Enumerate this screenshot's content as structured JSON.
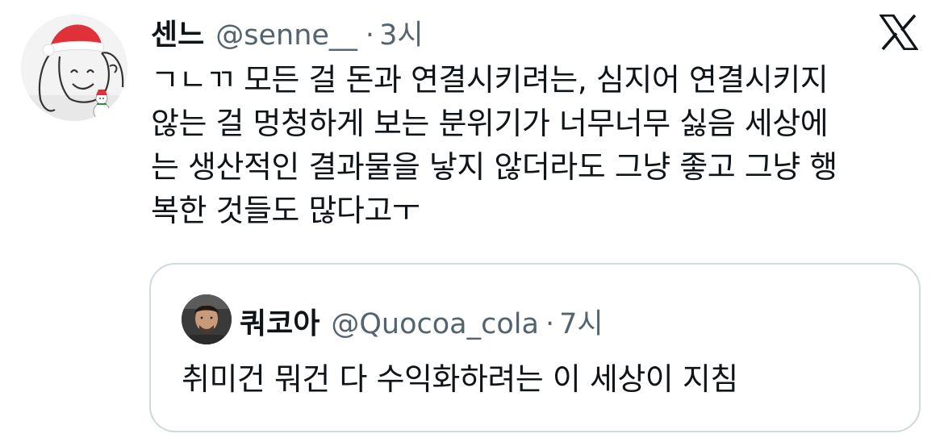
{
  "tweet": {
    "display_name": "센느",
    "handle": "@senne__",
    "separator": "·",
    "time": "3시",
    "text": "ㄱㄴㄲ 모든 걸 돈과 연결시키려는, 심지어 연결시키지\n않는 걸 멍청하게 보는 분위기가 너무너무 싫음 세상에\n는 생산적인 결과물을 낳지 않더라도 그냥 좋고 그냥 행\n복한 것들도 많다고ㅜ",
    "avatar_icon": "santa-hat-doodle-avatar",
    "brand_icon": "x-logo-icon"
  },
  "quote": {
    "display_name": "쿼코아",
    "handle": "@Quocoa_cola",
    "separator": "·",
    "time": "7시",
    "text": "취미건 뭐건 다 수익화하려는 이 세상이 지침",
    "avatar_icon": "profile-photo-avatar"
  },
  "colors": {
    "text_primary": "#0f1419",
    "text_secondary": "#536471",
    "border": "#cfd9de",
    "santa_hat": "#e0313b"
  }
}
